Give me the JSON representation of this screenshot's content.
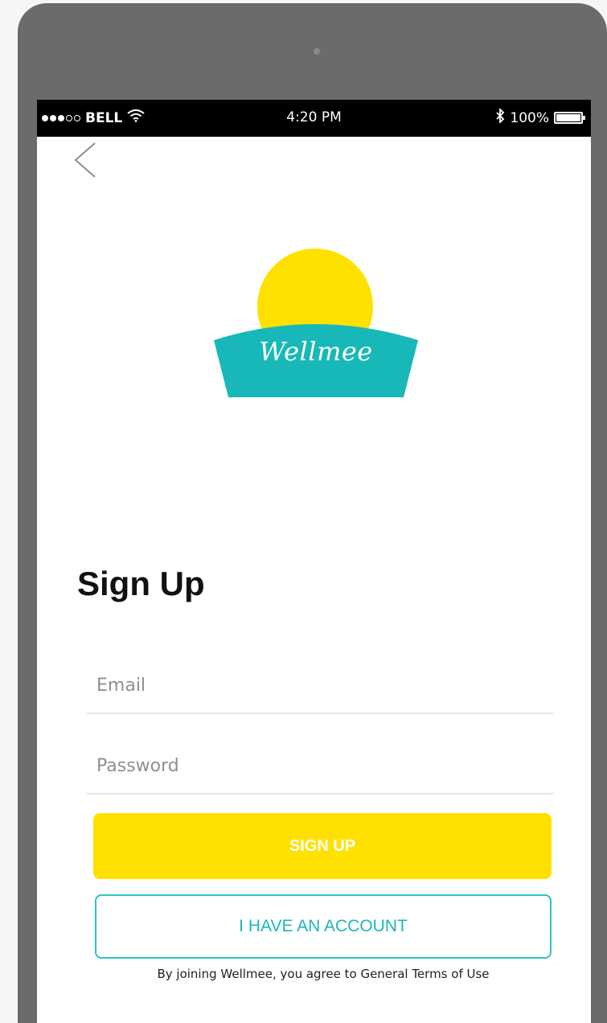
{
  "status_bar": {
    "carrier": "BELL",
    "time": "4:20 PM",
    "battery_text": "100%"
  },
  "brand": {
    "name": "Wellmee",
    "sun_color": "#ffe100",
    "banner_color": "#19b8b8"
  },
  "signup": {
    "title": "Sign Up",
    "email_placeholder": "Email",
    "password_placeholder": "Password",
    "signup_button": "SIGN UP",
    "account_button": "I HAVE AN ACCOUNT",
    "terms": "By joining Wellmee, you agree to General Terms of Use"
  },
  "icons": [
    "back-arrow-icon",
    "wifi-icon",
    "bluetooth-icon",
    "battery-icon",
    "signal-dots-icon"
  ]
}
